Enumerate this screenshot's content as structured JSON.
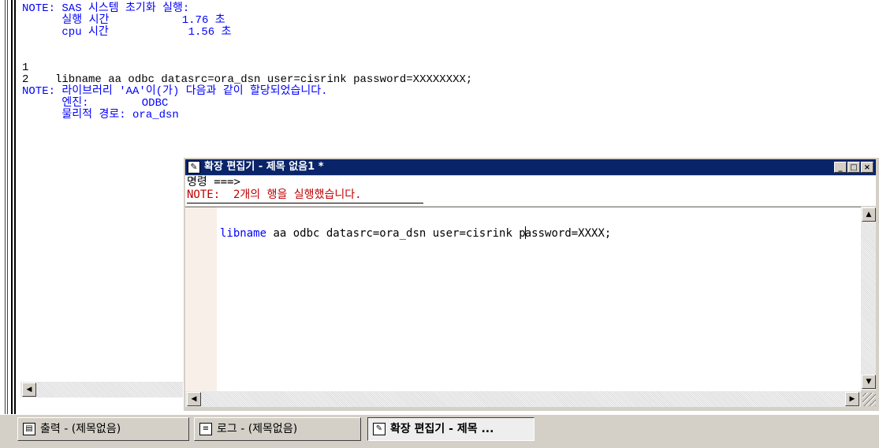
{
  "log": {
    "lines": [
      {
        "text": "NOTE: SAS 시스템 초기화 실행:",
        "color": "blue"
      },
      {
        "text": "      실행 시간           1.76 초",
        "color": "blue"
      },
      {
        "text": "      cpu 시간            1.56 초",
        "color": "blue"
      },
      {
        "text": "",
        "color": "black"
      },
      {
        "text": "",
        "color": "black"
      },
      {
        "text": "1",
        "color": "black"
      },
      {
        "text": "2    libname aa odbc datasrc=ora_dsn user=cisrink password=XXXXXXXX;",
        "color": "black"
      },
      {
        "text": "NOTE: 라이브러리 'AA'이(가) 다음과 같이 할당되었습니다.",
        "color": "blue"
      },
      {
        "text": "      엔진:        ODBC",
        "color": "blue"
      },
      {
        "text": "      물리적 경로: ora_dsn",
        "color": "blue"
      }
    ]
  },
  "editor": {
    "title": "확장 편집기 - 제목 없음1 *",
    "command_prompt": "명령 ===>",
    "note": "NOTE:  2개의 행을 실행했습니다.",
    "code_keyword": "libname",
    "code_before_caret": " aa odbc datasrc=ora_dsn user=cisrink p",
    "code_after_caret": "assword=XXXX;"
  },
  "taskbar": {
    "tabs": [
      {
        "label": "출력 - (제목없음)",
        "icon": "output-icon",
        "active": false
      },
      {
        "label": "로그 - (제목없음)",
        "icon": "log-icon",
        "active": false
      },
      {
        "label": "확장 편집기 - 제목 ...",
        "icon": "editor-icon",
        "active": true
      }
    ]
  },
  "colors": {
    "titlebar": "#0a246a",
    "log_note": "#0000ff",
    "editor_note": "#c00000"
  }
}
